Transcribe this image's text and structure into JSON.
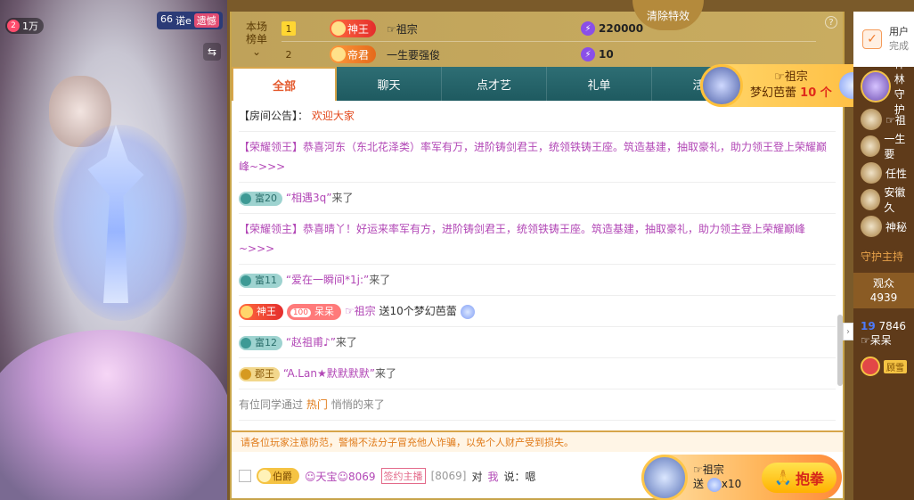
{
  "video": {
    "viewer_badge_num": "2",
    "viewer_badge_text": "1万",
    "top_right_num": "66",
    "top_right_label": "诺e",
    "top_right_tag": "遗憾"
  },
  "rank_board": {
    "title_line1": "本场",
    "title_line2": "榜单",
    "clear_effects": "清除特效",
    "help": "?",
    "rows": [
      {
        "rank": "1",
        "medal": "神王",
        "name": "☞祖宗",
        "score": "220000"
      },
      {
        "rank": "2",
        "medal": "帝君",
        "name": "一生要强俊",
        "score": "10"
      }
    ]
  },
  "tabs": [
    "全部",
    "聊天",
    "点才艺",
    "礼单",
    "活动"
  ],
  "messages": {
    "announce_label": "【房间公告】：",
    "announce_value": "欢迎大家",
    "sys1": "【荣耀领王】恭喜河东（东北花泽类）率军有万，进阶铸剑君王，统领铁铸王座。筑造基建，抽取豪礼，助力领王登上荣耀巅峰~>>>",
    "join1_level": "富20",
    "join1_user": "“相遇3q”",
    "join1_suffix": "来了",
    "sys2": "【荣耀领主】恭喜晴丫！好运来率军有方，进阶铸剑君王，统领铁铸王座。筑造基建，抽取豪礼，助力领主登上荣耀巅峰~>>>",
    "join2_level": "富11",
    "join2_user": "“爱在一瞬间*1j:”",
    "join2_suffix": "来了",
    "gift_medal": "神王",
    "gift_fan_num": "100",
    "gift_fan_name": "呆呆",
    "gift_user": "☞祖宗",
    "gift_text": "送10个梦幻芭蕾",
    "join3_level": "富12",
    "join3_user": "“赵祖甫♪”",
    "join3_suffix": "来了",
    "join4_level": "郡王",
    "join4_user": "“A.Lan★默默默默”",
    "join4_suffix": "来了",
    "pass_prefix": "有位同学通过",
    "pass_hot": "热门",
    "pass_suffix": "悄悄的来了"
  },
  "notice": "请各位玩家注意防范，警惕不法分子冒充他人诈骗，以免个人财产受到损失。",
  "bottom_msg": {
    "rank": "伯爵",
    "user": "☺天宝☺8069",
    "anchor": "签约主播",
    "id": "[8069]",
    "to": "对",
    "me": "我",
    "said": "说：嗯"
  },
  "gift_float": {
    "user": "☞祖宗",
    "send": "送",
    "count": "x10",
    "button": "抱拳"
  },
  "gift_banner": {
    "user": "☞祖宗",
    "gift": "梦幻芭蕾",
    "count": "10 个"
  },
  "right": {
    "task_line1": "用户",
    "task_line2": "完成",
    "guard_top_name": "神林",
    "guard_top_sub": "守护",
    "guards": [
      "☞祖",
      "一生要",
      "任性",
      "安徽久",
      "神秘"
    ],
    "guard_host": "守护主持",
    "audience_label": "观众",
    "audience_count": "4939",
    "viewer_num": "19",
    "viewer_id": "7846",
    "viewer_name": "☞呆呆",
    "vip_tag": "顾雪"
  }
}
